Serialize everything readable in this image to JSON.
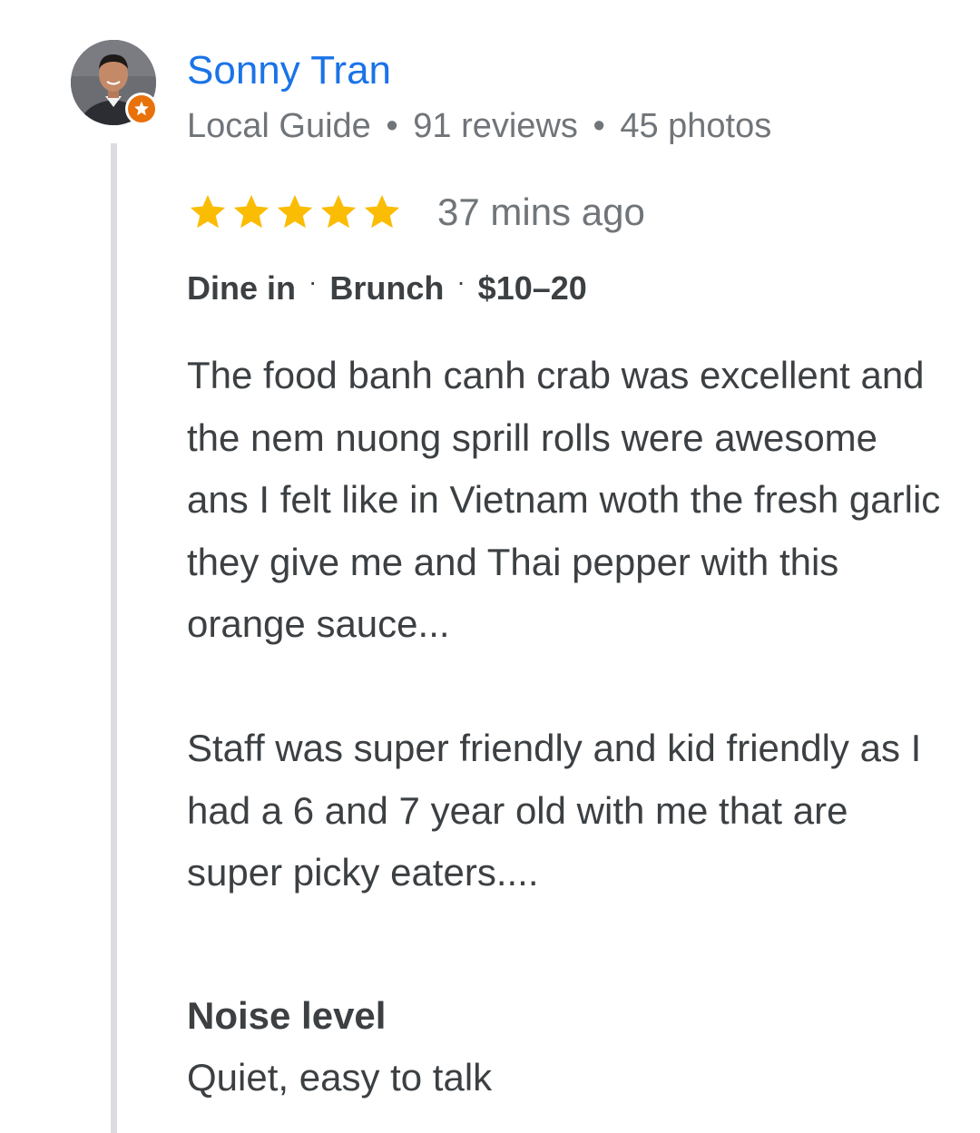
{
  "reviewer": {
    "name": "Sonny Tran",
    "level": "Local Guide",
    "reviews": "91 reviews",
    "photos": "45 photos",
    "separator": "•",
    "avatar_icon": "person-avatar",
    "badge_icon": "local-guide-star-icon"
  },
  "rating": {
    "stars": 5,
    "max_stars": 5,
    "star_color": "#fbbc04",
    "time_ago": "37 mins ago"
  },
  "tags": {
    "service": "Dine in",
    "meal": "Brunch",
    "price": "$10–20",
    "separator": "·"
  },
  "review": {
    "text": "The food banh canh crab was excellent and the nem nuong sprill rolls were awesome ans I felt like in Vietnam woth the fresh garlic they give me and Thai pepper with this orange sauce...\n\nStaff was super friendly and kid friendly as I had a 6 and 7 year old with me that are super picky eaters...."
  },
  "attributes": [
    {
      "title": "Noise level",
      "value": "Quiet, easy to talk"
    }
  ],
  "colors": {
    "name_link": "#1a73e8",
    "secondary_text": "#70757a",
    "body_text": "#3c4043",
    "thread_line": "#dadce0",
    "badge": "#e8710a"
  }
}
